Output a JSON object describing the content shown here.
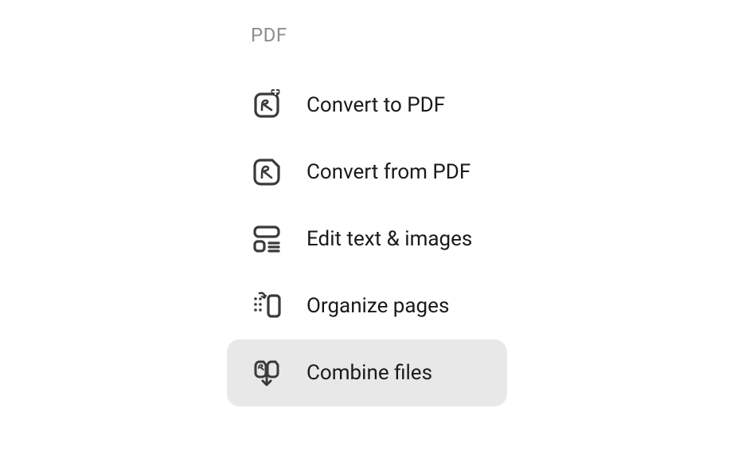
{
  "section": {
    "title": "PDF"
  },
  "menu": {
    "items": [
      {
        "label": "Convert to PDF",
        "icon": "convert-to-pdf-icon",
        "selected": false
      },
      {
        "label": "Convert from PDF",
        "icon": "convert-from-pdf-icon",
        "selected": false
      },
      {
        "label": "Edit text & images",
        "icon": "edit-text-images-icon",
        "selected": false
      },
      {
        "label": "Organize pages",
        "icon": "organize-pages-icon",
        "selected": false
      },
      {
        "label": "Combine files",
        "icon": "combine-files-icon",
        "selected": true
      }
    ]
  }
}
